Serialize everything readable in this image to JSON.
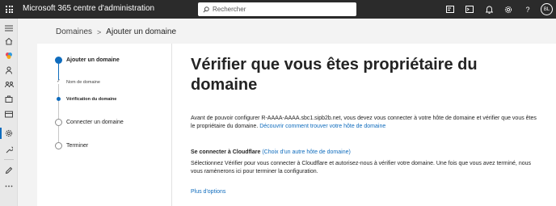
{
  "header": {
    "app_title": "Microsoft 365 centre d'administration",
    "search_placeholder": "Rechercher",
    "avatar_initials": "BL"
  },
  "breadcrumb": {
    "parent": "Domaines",
    "current": "Ajouter un domaine"
  },
  "stepper": {
    "steps": [
      {
        "label": "Ajouter un domaine",
        "state": "current"
      },
      {
        "label": "Nom de domaine",
        "state": "done",
        "sub": true
      },
      {
        "label": "Vérification du domaine",
        "state": "current",
        "sub": true
      },
      {
        "label": "Connecter un domaine",
        "state": "todo"
      },
      {
        "label": "Terminer",
        "state": "todo"
      }
    ]
  },
  "content": {
    "heading": "Vérifier que vous êtes propriétaire du domaine",
    "intro_text": "Avant de pouvoir configurer R-AAAA-AAAA.sbc1.sipb2b.net, vous devez vous connecter à votre hôte de domaine et vérifier que vous êtes le propriétaire du domaine.",
    "intro_link": "Découvrir comment trouver votre hôte de domaine",
    "connect_title": "Se connecter à Cloudflare",
    "connect_link": "(Choix d'un autre hôte de domaine)",
    "connect_text": "Sélectionnez Vérifier pour vous connecter à Cloudflare et autorisez-nous à vérifier votre domaine. Une fois que vous avez terminé, nous vous ramènerons ici pour terminer la configuration.",
    "more_options": "Plus d'options"
  },
  "colors": {
    "accent": "#0f6cbd",
    "topbar": "#2b2b2b"
  }
}
